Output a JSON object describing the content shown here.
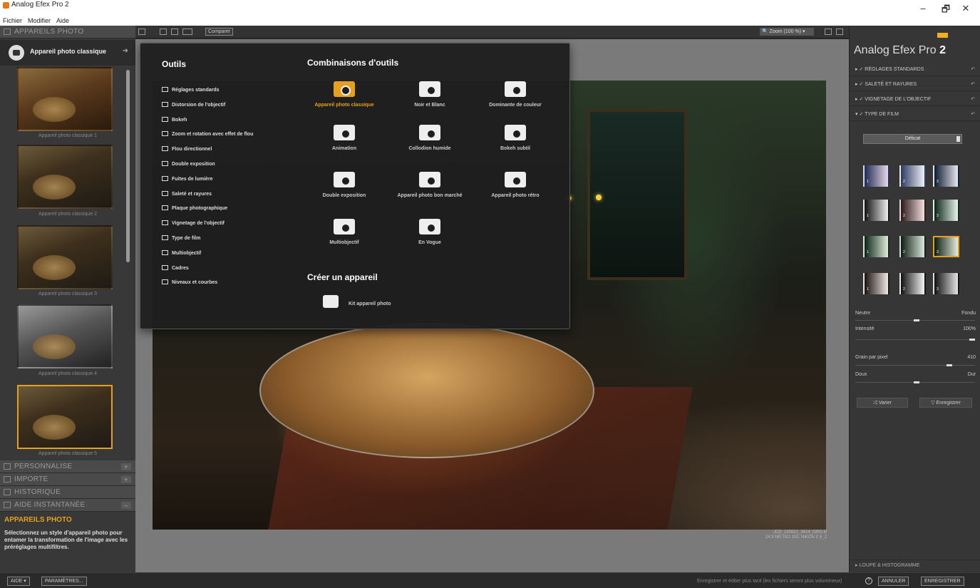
{
  "window": {
    "title": "Analog Efex Pro 2",
    "menu": [
      "Fichier",
      "Modifier",
      "Aide"
    ],
    "controls": [
      "–",
      "🗗",
      "✕"
    ]
  },
  "left_panel": {
    "header": "APPAREILS PHOTO",
    "camera_selected": "Appareil photo classique",
    "thumbnails": [
      {
        "label": "Appareil photo classique 1",
        "style": "sepia"
      },
      {
        "label": "Appareil photo classique 2",
        "style": "color"
      },
      {
        "label": "Appareil photo classique 3",
        "style": "color"
      },
      {
        "label": "Appareil photo classique 4",
        "style": "bw"
      },
      {
        "label": "Appareil photo classique 5",
        "style": "color"
      }
    ],
    "selected_thumbnail": "Appareil photo classique 5",
    "sections": [
      "PERSONNALISE",
      "IMPORTE",
      "HISTORIQUE",
      "AIDE INSTANTANÉE"
    ],
    "help_title": "APPAREILS PHOTO",
    "help_text": "Sélectionnez un style d'appareil photo pour entamer la transformation de l'image avec les préréglages multifiltres."
  },
  "toolbar": {
    "compare_label": "Comparer",
    "zoom_label": "Zoom (100 %)"
  },
  "popup": {
    "tools_title": "Outils",
    "tools": [
      "Réglages standards",
      "Distorsion de l'objectif",
      "Bokeh",
      "Zoom et rotation avec effet de flou",
      "Flou directionnel",
      "Double exposition",
      "Fuites de lumière",
      "Saleté et rayures",
      "Plaque photographique",
      "Vignetage de l'objectif",
      "Type de film",
      "Multiobjectif",
      "Cadres",
      "Niveaux et courbes"
    ],
    "combos_title": "Combinaisons d'outils",
    "combos": [
      {
        "label": "Appareil photo classique",
        "active": true
      },
      {
        "label": "Noir et Blanc",
        "active": false
      },
      {
        "label": "Dominante de couleur",
        "active": false
      },
      {
        "label": "Animation",
        "active": false
      },
      {
        "label": "Collodion humide",
        "active": false
      },
      {
        "label": "Bokeh subtil",
        "active": false
      },
      {
        "label": "Double exposition",
        "active": false
      },
      {
        "label": "Appareil photo bon marché",
        "active": false
      },
      {
        "label": "Appareil photo rétro",
        "active": false
      },
      {
        "label": "Multiobjectif",
        "active": false
      },
      {
        "label": "En Vogue",
        "active": false
      }
    ],
    "create_title": "Créer un appareil",
    "kit_label": "Kit appareil photo"
  },
  "photo_meta": {
    "filename": "JCD_130521_3414_ORG.tif",
    "details": "24.3 MP, ISO 100, NIKON Z 6_2"
  },
  "right_panel": {
    "brand": "Analog Efex Pro",
    "brand_version": "2",
    "filters": [
      {
        "label": "RÉGLAGES STANDARDS",
        "expanded": false
      },
      {
        "label": "SALETÉ ET RAYURES",
        "expanded": false
      },
      {
        "label": "VIGNETAGE DE L'OBJECTIF",
        "expanded": false
      },
      {
        "label": "TYPE DE FILM",
        "expanded": true
      }
    ],
    "film_dropdown": "Délicat",
    "swatches": [
      {
        "num": "1",
        "from": "#1e2a55",
        "to": "#e8d8e8"
      },
      {
        "num": "2",
        "from": "#2a3a60",
        "to": "#f0f0f8"
      },
      {
        "num": "3",
        "from": "#0c1a30",
        "to": "#e8e8f0"
      },
      {
        "num": "1",
        "from": "#111111",
        "to": "#eeeeee"
      },
      {
        "num": "2",
        "from": "#2a1818",
        "to": "#f4dede"
      },
      {
        "num": "3",
        "from": "#0a2418",
        "to": "#e8f4ec"
      },
      {
        "num": "1",
        "from": "#0a2418",
        "to": "#e0ecd8"
      },
      {
        "num": "2",
        "from": "#0c1c14",
        "to": "#dde8dd"
      },
      {
        "num": "3",
        "from": "#0a1a10",
        "to": "#e4ecdc"
      },
      {
        "num": "1",
        "from": "#1a1010",
        "to": "#f0e8e4"
      },
      {
        "num": "2",
        "from": "#101010",
        "to": "#f4f4f4"
      },
      {
        "num": "3",
        "from": "#101010",
        "to": "#e4e4e4"
      }
    ],
    "selected_swatch_index": 8,
    "neutral_label": "Neutre",
    "fondu_label": "Fondu",
    "intensity_label": "Intensité",
    "intensity_value": "100%",
    "grain_label": "Grain par pixel",
    "grain_value": "410",
    "doux_label": "Doux",
    "dur_label": "Dur",
    "varier_label": "Varier",
    "enregistrer_label": "Enregistrer",
    "loupe_label": "LOUPE & HISTOGRAMME"
  },
  "bottom_bar": {
    "aide_label": "AIDE",
    "params_label": "PARAMÈTRES...",
    "save_later_text": "Enregistrer et éditer plus tard (les fichiers seront plus volumineux)",
    "annuler_label": "ANNULER",
    "enregistrer_label": "ENREGISTRER"
  },
  "colors": {
    "accent": "#e6a020",
    "panel": "#383838",
    "background": "#2b2b2b"
  }
}
